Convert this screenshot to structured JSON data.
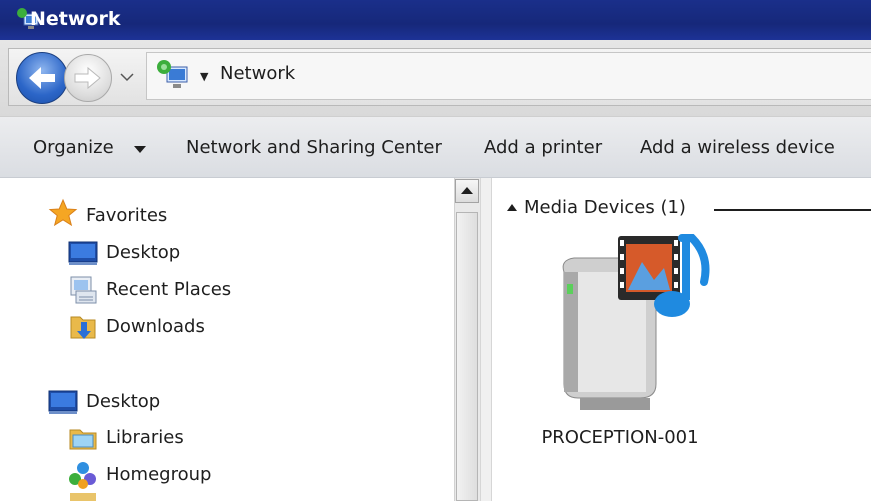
{
  "window": {
    "title": "Network"
  },
  "address_bar": {
    "location": "Network"
  },
  "command_bar": {
    "organize": "Organize",
    "sharing_center": "Network and Sharing Center",
    "add_printer": "Add a printer",
    "add_wireless": "Add a wireless device"
  },
  "nav": {
    "favorites": {
      "label": "Favorites",
      "items": [
        {
          "label": "Desktop",
          "icon": "desktop-icon"
        },
        {
          "label": "Recent Places",
          "icon": "recent-places-icon"
        },
        {
          "label": "Downloads",
          "icon": "downloads-folder-icon"
        }
      ]
    },
    "desktop": {
      "label": "Desktop",
      "items": [
        {
          "label": "Libraries",
          "icon": "libraries-icon"
        },
        {
          "label": "Homegroup",
          "icon": "homegroup-icon"
        }
      ]
    }
  },
  "content": {
    "group_header": "Media Devices (1)",
    "devices": [
      {
        "label": "PROCEPTION-001",
        "icon": "media-device-icon"
      }
    ]
  },
  "colors": {
    "titlebar": "#16287a",
    "accent_blue": "#2c66c8",
    "favorites_star": "#f5a623"
  }
}
